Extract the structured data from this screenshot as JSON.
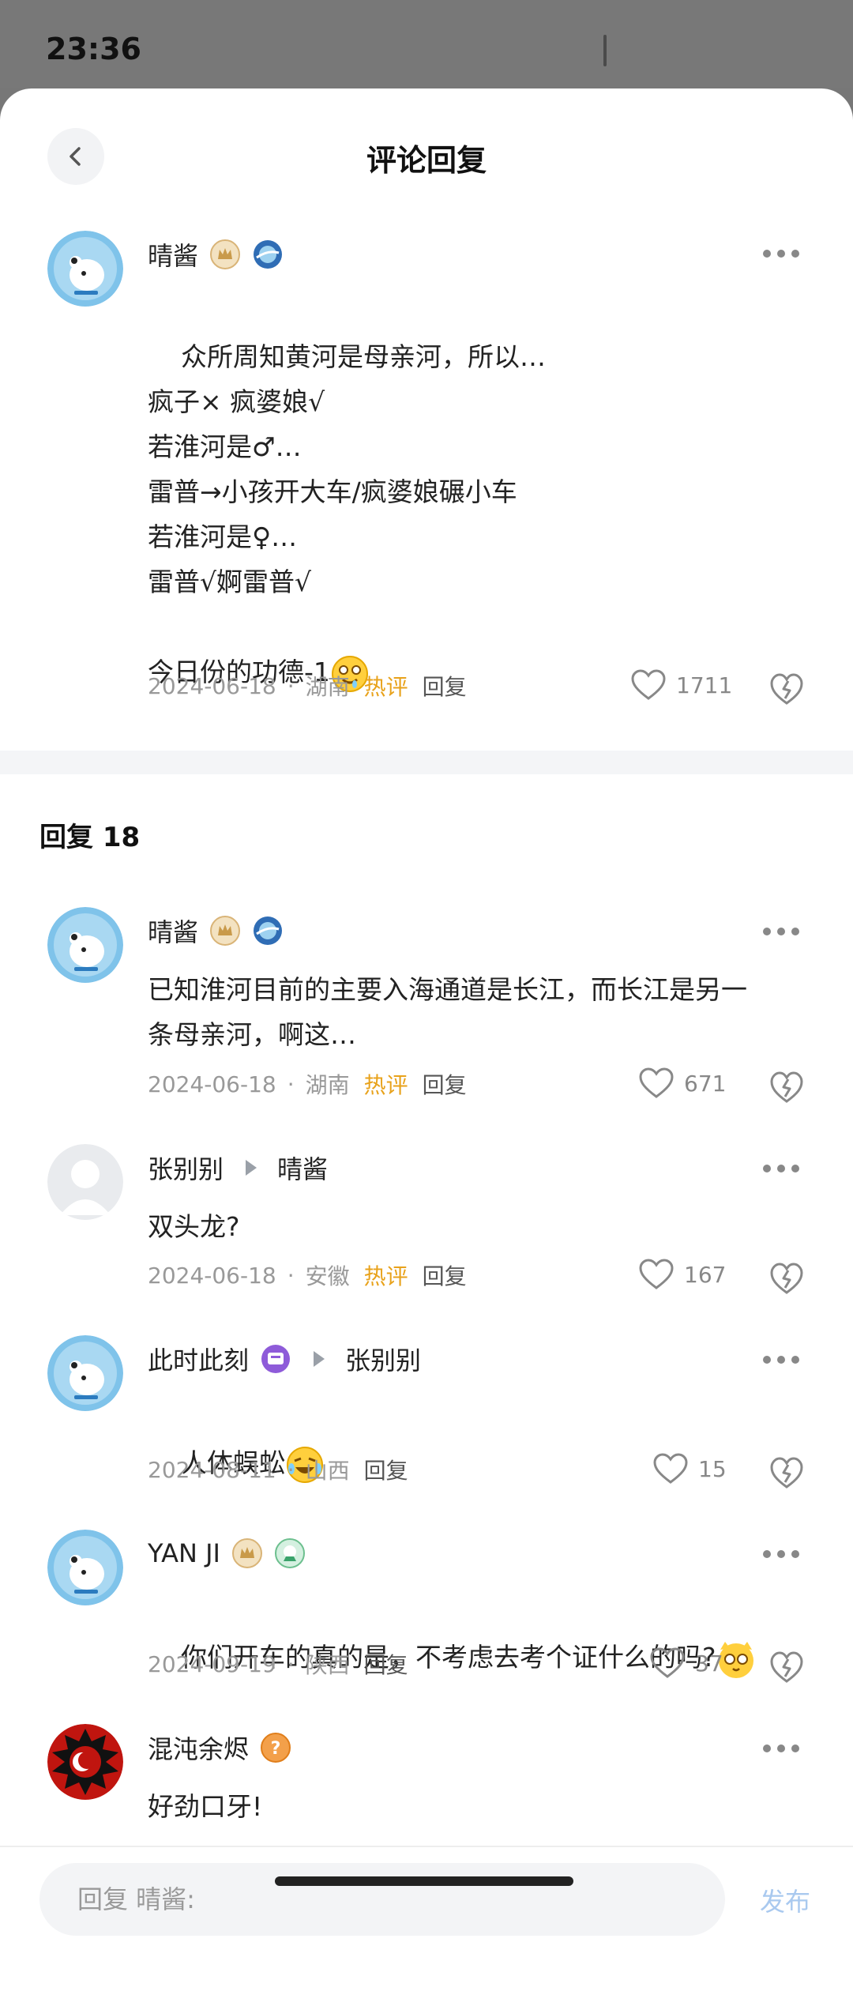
{
  "status_bar": {
    "time": "23:36"
  },
  "header": {
    "title": "评论回复"
  },
  "main_comment": {
    "username": "晴酱",
    "content": "众所周知黄河是母亲河，所以…\n疯子× 疯婆娘√\n若淮河是♂…\n雷普→小孩开大车/疯婆娘碾小车\n若淮河是♀…\n雷普√婀雷普√\n\n今日份的功德-1",
    "date": "2024-06-18",
    "location": "湖南",
    "hot_label": "热评",
    "reply_label": "回复",
    "likes": "1711"
  },
  "replies_header": {
    "label": "回复 18"
  },
  "replies": [
    {
      "username": "晴酱",
      "reply_to": "",
      "content": "已知淮河目前的主要入海通道是长江，而长江是另一\n条母亲河，啊这…",
      "date": "2024-06-18",
      "location": "湖南",
      "hot_label": "热评",
      "reply_label": "回复",
      "likes": "671"
    },
    {
      "username": "张别别",
      "reply_to": "晴酱",
      "content": "双头龙?",
      "date": "2024-06-18",
      "location": "安徽",
      "hot_label": "热评",
      "reply_label": "回复",
      "likes": "167"
    },
    {
      "username": "此时此刻",
      "reply_to": "张别别",
      "content": "人体蜈蚣",
      "date": "2024-08-11",
      "location": "山西",
      "hot_label": "",
      "reply_label": "回复",
      "likes": "15"
    },
    {
      "username": "YAN JI",
      "reply_to": "",
      "content": "你们开车的真的是，不考虑去考个证什么的吗?",
      "date": "2024-09-19",
      "location": "陕西",
      "hot_label": "",
      "reply_label": "回复",
      "likes": "37"
    },
    {
      "username": "混沌余烬",
      "reply_to": "",
      "content": "好劲口牙!",
      "date": "",
      "location": "",
      "hot_label": "",
      "reply_label": "",
      "likes": ""
    }
  ],
  "bottom_bar": {
    "input_placeholder": "回复 晴酱:",
    "publish_label": "发布"
  },
  "colors": {
    "hot": "#e8a21b",
    "publish": "#a9c9ef",
    "avatar_bg": "#7fc3ea"
  }
}
